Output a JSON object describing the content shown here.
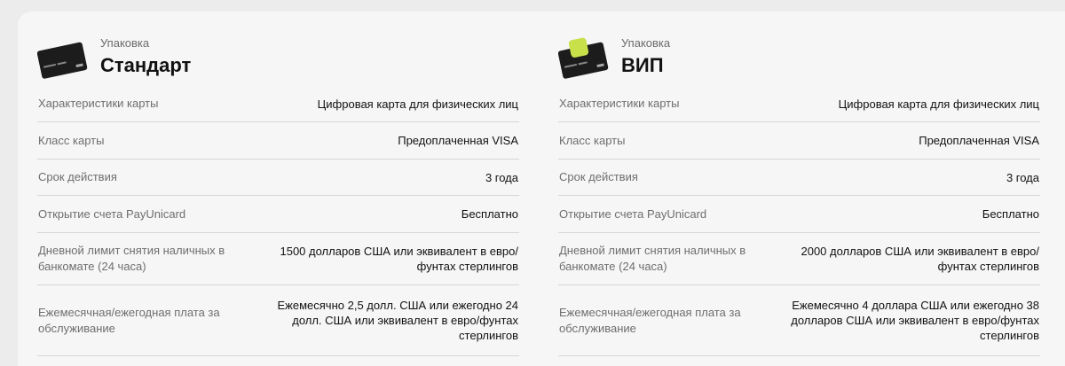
{
  "packages": [
    {
      "subtitle": "Упаковка",
      "title": "Стандарт",
      "icon": "black-card-icon",
      "rows": [
        {
          "label": "Характеристики карты",
          "value": "Цифровая карта для физических лиц"
        },
        {
          "label": "Класс карты",
          "value": "Предоплаченная VISA"
        },
        {
          "label": "Срок действия",
          "value": "3 года"
        },
        {
          "label": "Открытие счета PayUnicard",
          "value": "Бесплатно"
        },
        {
          "label": "Дневной лимит снятия наличных в банкомате (24 часа)",
          "value": "1500 долларов США или эквивалент в евро/фунтах стерлингов"
        },
        {
          "label": "Ежемесячная/ежегодная плата за обслуживание",
          "value": "Ежемесячно 2,5 долл. США или ежегодно 24 долл. США или эквивалент в евро/фунтах стерлингов"
        }
      ]
    },
    {
      "subtitle": "Упаковка",
      "title": "ВИП",
      "icon": "black-card-with-green-square-icon",
      "rows": [
        {
          "label": "Характеристики карты",
          "value": "Цифровая карта для физических лиц"
        },
        {
          "label": "Класс карты",
          "value": "Предоплаченная VISA"
        },
        {
          "label": "Срок действия",
          "value": "3 года"
        },
        {
          "label": "Открытие счета PayUnicard",
          "value": "Бесплатно"
        },
        {
          "label": "Дневной лимит снятия наличных в банкомате (24 часа)",
          "value": "2000 долларов США или эквивалент в евро/фунтах стерлингов"
        },
        {
          "label": "Ежемесячная/ежегодная плата за обслуживание",
          "value": "Ежемесячно 4 доллара США или ежегодно 38 долларов США или эквивалент в евро/фунтах стерлингов"
        }
      ]
    }
  ],
  "colors": {
    "card": "#1c1c1c",
    "accent": "#c8e04a",
    "divider": "#d6d6d6"
  }
}
